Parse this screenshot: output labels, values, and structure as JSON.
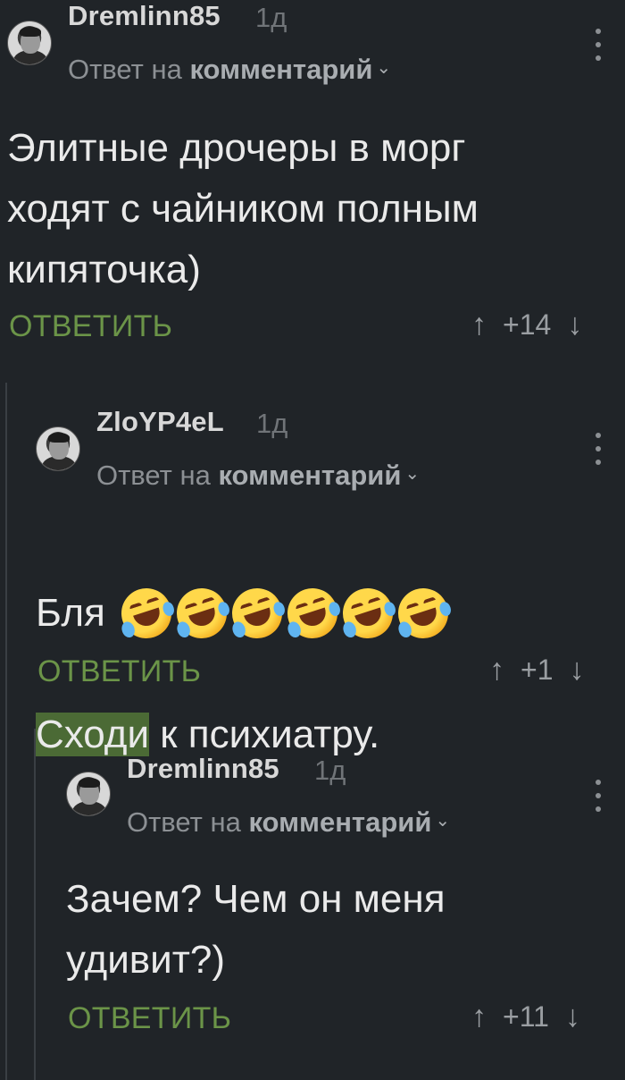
{
  "comments": [
    {
      "username": "Dremlinn85",
      "time": "1д",
      "reply_prefix": "Ответ на",
      "reply_target": "комментарий",
      "text": "Элитные дрочеры в морг\nходят с чайником полным\nкипяточка)",
      "reply_label": "ОТВЕТИТЬ",
      "rating": "+14"
    },
    {
      "username": "ZloYP4eL",
      "time": "1д",
      "reply_prefix": "Ответ на",
      "reply_target": "комментарий",
      "text_line1": "Бля",
      "text_highlight": "Сходи",
      "text_rest": " к психиатру.",
      "reply_label": "ОТВЕТИТЬ",
      "rating": "+1"
    },
    {
      "username": "Dremlinn85",
      "time": "1д",
      "reply_prefix": "Ответ на",
      "reply_target": "комментарий",
      "text": "Зачем? Чем он меня\nудивит?)",
      "reply_label": "ОТВЕТИТЬ",
      "rating": "+11"
    }
  ],
  "icons": {
    "upvote": "arrow-up-icon",
    "downvote": "arrow-down-icon",
    "menu": "more-vertical-icon",
    "chevron": "chevron-down-icon",
    "emoji": "rolling-on-floor-laughing-emoji"
  },
  "colors": {
    "background": "#202428",
    "accent": "#6b9448",
    "highlight": "#4b6a35"
  }
}
